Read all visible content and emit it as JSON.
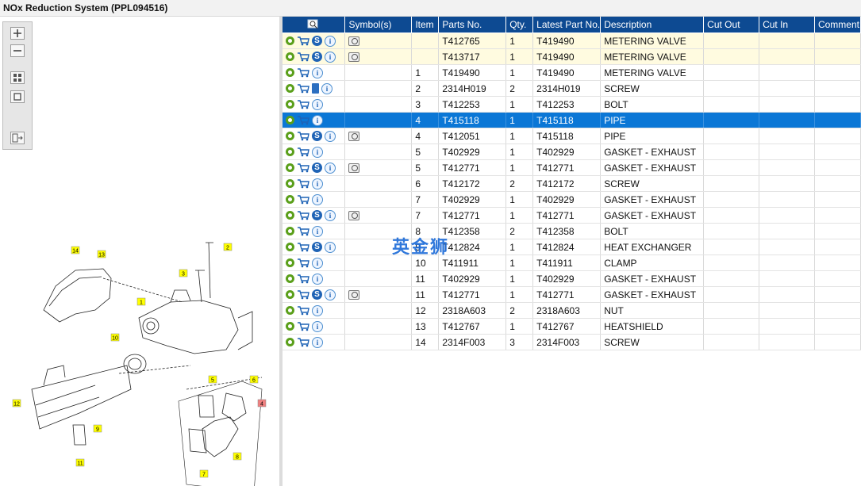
{
  "window": {
    "title": "NOx Reduction System (PPL094516)"
  },
  "left_toolbar": {
    "buttons": [
      {
        "name": "zoom-in",
        "symbol": "+"
      },
      {
        "name": "zoom-out",
        "symbol": "−"
      },
      {
        "name": "fit-page",
        "symbol": "▦"
      },
      {
        "name": "actual-size",
        "symbol": "□"
      },
      {
        "name": "export",
        "symbol": "⇥"
      }
    ]
  },
  "diagram": {
    "callouts": [
      "14",
      "13",
      "2",
      "3",
      "1",
      "10",
      "5",
      "6",
      "4",
      "12",
      "9",
      "11",
      "7",
      "8"
    ]
  },
  "table": {
    "columns": [
      "Symbol(s)",
      "Item",
      "Parts No.",
      "Qty.",
      "Latest Part No.",
      "Description",
      "Cut Out",
      "Cut In",
      "Comment"
    ],
    "rows": [
      {
        "item": "",
        "part": "T412765",
        "qty": "1",
        "latest": "T419490",
        "desc": "METERING VALVE",
        "style": "yellow",
        "icons": [
          "gear",
          "cart",
          "s",
          "i"
        ],
        "sym": true
      },
      {
        "item": "",
        "part": "T413717",
        "qty": "1",
        "latest": "T419490",
        "desc": "METERING VALVE",
        "style": "yellow",
        "icons": [
          "gear",
          "cart",
          "s",
          "i"
        ],
        "sym": true
      },
      {
        "item": "1",
        "part": "T419490",
        "qty": "1",
        "latest": "T419490",
        "desc": "METERING VALVE",
        "style": "",
        "icons": [
          "gear",
          "cart",
          "i"
        ],
        "sym": false
      },
      {
        "item": "2",
        "part": "2314H019",
        "qty": "2",
        "latest": "2314H019",
        "desc": "SCREW",
        "style": "",
        "icons": [
          "gear",
          "cart",
          "book",
          "i"
        ],
        "sym": false
      },
      {
        "item": "3",
        "part": "T412253",
        "qty": "1",
        "latest": "T412253",
        "desc": "BOLT",
        "style": "",
        "icons": [
          "gear",
          "cart",
          "i"
        ],
        "sym": false
      },
      {
        "item": "4",
        "part": "T415118",
        "qty": "1",
        "latest": "T415118",
        "desc": "PIPE",
        "style": "sel",
        "icons": [
          "gear",
          "cart",
          "i"
        ],
        "sym": false
      },
      {
        "item": "4",
        "part": "T412051",
        "qty": "1",
        "latest": "T415118",
        "desc": "PIPE",
        "style": "",
        "icons": [
          "gear",
          "cart",
          "s",
          "i"
        ],
        "sym": true
      },
      {
        "item": "5",
        "part": "T402929",
        "qty": "1",
        "latest": "T402929",
        "desc": "GASKET - EXHAUST",
        "style": "",
        "icons": [
          "gear",
          "cart",
          "i"
        ],
        "sym": false
      },
      {
        "item": "5",
        "part": "T412771",
        "qty": "1",
        "latest": "T412771",
        "desc": "GASKET - EXHAUST",
        "style": "",
        "icons": [
          "gear",
          "cart",
          "s",
          "i"
        ],
        "sym": true
      },
      {
        "item": "6",
        "part": "T412172",
        "qty": "2",
        "latest": "T412172",
        "desc": "SCREW",
        "style": "",
        "icons": [
          "gear",
          "cart",
          "i"
        ],
        "sym": false
      },
      {
        "item": "7",
        "part": "T402929",
        "qty": "1",
        "latest": "T402929",
        "desc": "GASKET - EXHAUST",
        "style": "",
        "icons": [
          "gear",
          "cart",
          "i"
        ],
        "sym": false
      },
      {
        "item": "7",
        "part": "T412771",
        "qty": "1",
        "latest": "T412771",
        "desc": "GASKET - EXHAUST",
        "style": "",
        "icons": [
          "gear",
          "cart",
          "s",
          "i"
        ],
        "sym": true
      },
      {
        "item": "8",
        "part": "T412358",
        "qty": "2",
        "latest": "T412358",
        "desc": "BOLT",
        "style": "",
        "icons": [
          "gear",
          "cart",
          "i"
        ],
        "sym": false
      },
      {
        "item": "9",
        "part": "T412824",
        "qty": "1",
        "latest": "T412824",
        "desc": "HEAT EXCHANGER",
        "style": "",
        "icons": [
          "gear",
          "cart",
          "s",
          "i"
        ],
        "sym": false
      },
      {
        "item": "10",
        "part": "T411911",
        "qty": "1",
        "latest": "T411911",
        "desc": "CLAMP",
        "style": "",
        "icons": [
          "gear",
          "cart",
          "i"
        ],
        "sym": false
      },
      {
        "item": "11",
        "part": "T402929",
        "qty": "1",
        "latest": "T402929",
        "desc": "GASKET - EXHAUST",
        "style": "",
        "icons": [
          "gear",
          "cart",
          "i"
        ],
        "sym": false
      },
      {
        "item": "11",
        "part": "T412771",
        "qty": "1",
        "latest": "T412771",
        "desc": "GASKET - EXHAUST",
        "style": "",
        "icons": [
          "gear",
          "cart",
          "s",
          "i"
        ],
        "sym": true
      },
      {
        "item": "12",
        "part": "2318A603",
        "qty": "2",
        "latest": "2318A603",
        "desc": "NUT",
        "style": "",
        "icons": [
          "gear",
          "cart",
          "i"
        ],
        "sym": false
      },
      {
        "item": "13",
        "part": "T412767",
        "qty": "1",
        "latest": "T412767",
        "desc": "HEATSHIELD",
        "style": "",
        "icons": [
          "gear",
          "cart",
          "i"
        ],
        "sym": false
      },
      {
        "item": "14",
        "part": "2314F003",
        "qty": "3",
        "latest": "2314F003",
        "desc": "SCREW",
        "style": "",
        "icons": [
          "gear",
          "cart",
          "i"
        ],
        "sym": false
      }
    ]
  },
  "watermark": {
    "text": "英金狮"
  },
  "colors": {
    "header": "#0d4a92",
    "selected": "#0b77d6",
    "highlight": "#fffbe0",
    "callout": "#ffff00"
  }
}
